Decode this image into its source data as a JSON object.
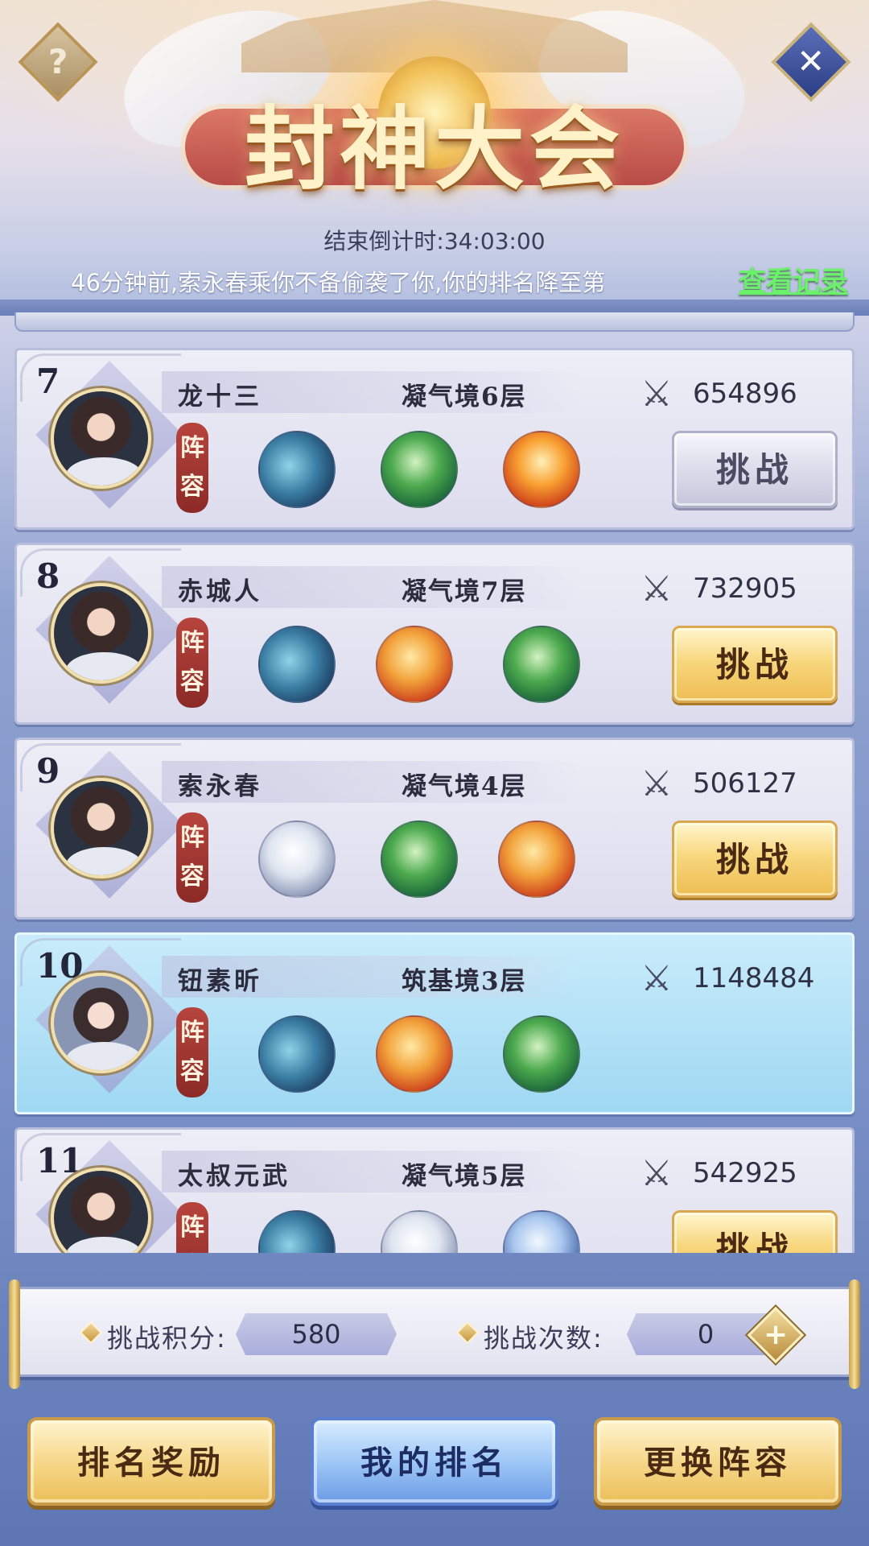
{
  "header": {
    "title": "封神大会",
    "help_icon": "question-icon",
    "help_glyph": "?",
    "close_icon": "close-icon",
    "close_glyph": "✕",
    "countdown": "结束倒计时:34:03:00",
    "notice": "46分钟前,索永春乘你不备偷袭了你,你的排名降至第",
    "view_record_label": "查看记录"
  },
  "ranking": {
    "lineup_label": "阵容",
    "challenge_label": "挑战",
    "power_icon": "crossed-swords-icon",
    "power_glyph": "⚔",
    "entries": [
      {
        "rank": "7",
        "name": "龙十三",
        "realm": "凝气境6层",
        "power": "654896",
        "lineup": [
          "whale",
          "green-dragon",
          "phoenix"
        ],
        "challenge_state": "disabled"
      },
      {
        "rank": "8",
        "name": "赤城人",
        "realm": "凝气境7层",
        "power": "732905",
        "lineup": [
          "whale",
          "orange-dragon",
          "green-dragon"
        ],
        "challenge_state": "available"
      },
      {
        "rank": "9",
        "name": "索永春",
        "realm": "凝气境4层",
        "power": "506127",
        "lineup": [
          "white-tiger",
          "green-dragon",
          "orange-dragon"
        ],
        "challenge_state": "available"
      },
      {
        "rank": "10",
        "name": "钮素昕",
        "realm": "筑基境3层",
        "power": "1148484",
        "lineup": [
          "whale",
          "orange-dragon",
          "green-dragon"
        ],
        "is_self": true
      },
      {
        "rank": "11",
        "name": "太叔元武",
        "realm": "凝气境5层",
        "power": "542925",
        "lineup": [
          "whale",
          "white-tiger",
          "ice-dragon"
        ],
        "challenge_state": "available"
      }
    ]
  },
  "stats": {
    "points_label": "挑战积分:",
    "points_value": "580",
    "attempts_label": "挑战次数:",
    "attempts_value": "0",
    "add_icon": "plus-icon",
    "add_glyph": "+"
  },
  "bottom_buttons": {
    "rank_reward": "排名奖励",
    "my_rank": "我的排名",
    "change_lineup": "更换阵容"
  },
  "colors": {
    "record_link": "#6bf06a",
    "self_row": "#9fd8f2",
    "gold_button": "#f6d88b",
    "blue_button": "#9fc8f6",
    "lineup_tag": "#8c2a27"
  }
}
